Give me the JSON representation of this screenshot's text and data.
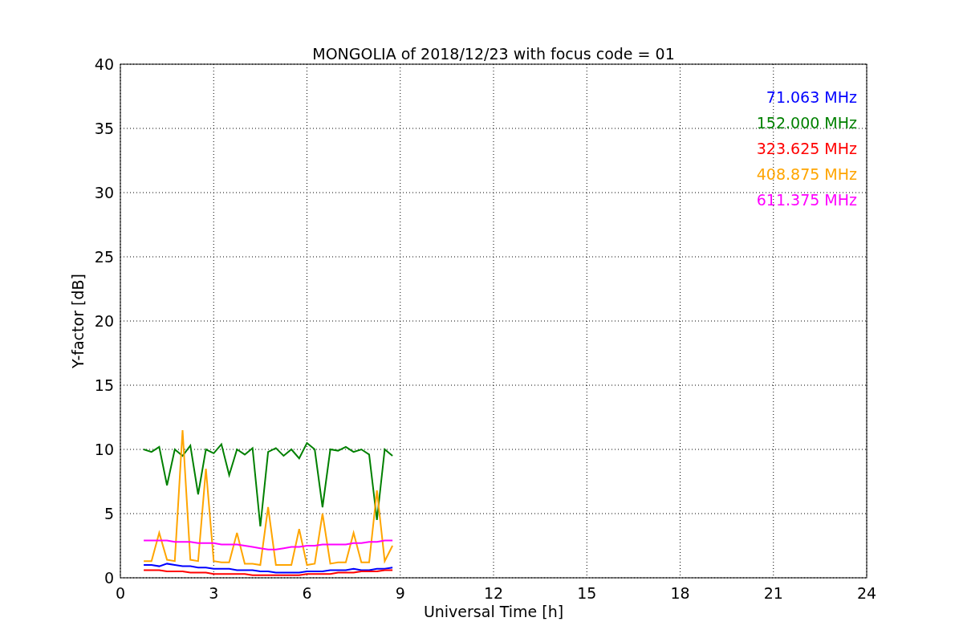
{
  "chart_data": {
    "type": "line",
    "title": "MONGOLIA of 2018/12/23 with focus code = 01",
    "xlabel": "Universal Time [h]",
    "ylabel": "Y-factor [dB]",
    "x": [
      0.75,
      1,
      1.25,
      1.5,
      1.75,
      2,
      2.25,
      2.5,
      2.75,
      3,
      3.25,
      3.5,
      3.75,
      4,
      4.25,
      4.5,
      4.75,
      5,
      5.25,
      5.5,
      5.75,
      6,
      6.25,
      6.5,
      6.75,
      7,
      7.25,
      7.5,
      7.75,
      8,
      8.25,
      8.5,
      8.75
    ],
    "series": [
      {
        "name": "71.063 MHz",
        "color": "#0000ff",
        "values": [
          1.0,
          1.0,
          0.9,
          1.1,
          1.0,
          0.9,
          0.9,
          0.8,
          0.8,
          0.7,
          0.7,
          0.7,
          0.6,
          0.6,
          0.6,
          0.5,
          0.5,
          0.4,
          0.4,
          0.4,
          0.4,
          0.5,
          0.5,
          0.5,
          0.6,
          0.6,
          0.6,
          0.7,
          0.6,
          0.6,
          0.7,
          0.7,
          0.8
        ]
      },
      {
        "name": "152.000 MHz",
        "color": "#008000",
        "values": [
          10,
          9.8,
          10.2,
          7.2,
          10,
          9.5,
          10.3,
          6.5,
          10,
          9.7,
          10.4,
          8,
          10,
          9.6,
          10.1,
          4,
          9.8,
          10.1,
          9.5,
          10,
          9.3,
          10.5,
          10,
          5.5,
          10,
          9.9,
          10.2,
          9.8,
          10,
          9.6,
          4.5,
          10,
          9.5
        ]
      },
      {
        "name": "323.625 MHz",
        "color": "#ff0000",
        "values": [
          0.6,
          0.6,
          0.6,
          0.5,
          0.5,
          0.5,
          0.4,
          0.4,
          0.4,
          0.3,
          0.3,
          0.3,
          0.3,
          0.3,
          0.2,
          0.2,
          0.2,
          0.2,
          0.2,
          0.2,
          0.2,
          0.3,
          0.3,
          0.3,
          0.3,
          0.4,
          0.4,
          0.4,
          0.5,
          0.5,
          0.5,
          0.6,
          0.6
        ]
      },
      {
        "name": "408.875 MHz",
        "color": "#ffa500",
        "values": [
          1.3,
          1.3,
          3.5,
          1.4,
          1.3,
          11.5,
          1.4,
          1.3,
          8.5,
          1.3,
          1.2,
          1.2,
          3.5,
          1.1,
          1.1,
          1.0,
          5.5,
          1.0,
          1.0,
          1.0,
          3.8,
          1.0,
          1.1,
          5.0,
          1.1,
          1.2,
          1.2,
          3.5,
          1.2,
          1.2,
          6.8,
          1.3,
          2.5
        ]
      },
      {
        "name": "611.375 MHz",
        "color": "#ff00ff",
        "values": [
          2.9,
          2.9,
          2.9,
          2.9,
          2.8,
          2.8,
          2.8,
          2.7,
          2.7,
          2.7,
          2.6,
          2.6,
          2.6,
          2.5,
          2.4,
          2.3,
          2.2,
          2.2,
          2.3,
          2.4,
          2.4,
          2.5,
          2.5,
          2.6,
          2.6,
          2.6,
          2.6,
          2.7,
          2.7,
          2.8,
          2.8,
          2.9,
          2.9
        ]
      }
    ],
    "xlim": [
      0,
      24
    ],
    "ylim": [
      0,
      40
    ],
    "xticks": [
      0,
      3,
      6,
      9,
      12,
      15,
      18,
      21,
      24
    ],
    "yticks": [
      0,
      5,
      10,
      15,
      20,
      25,
      30,
      35,
      40
    ],
    "grid": true
  }
}
